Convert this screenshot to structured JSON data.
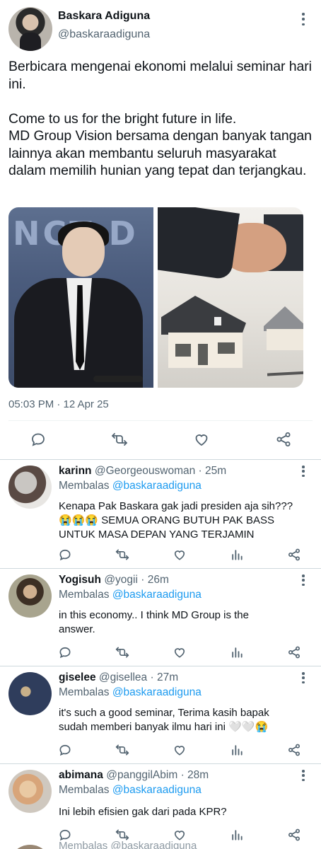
{
  "main_tweet": {
    "author_name": "Baskara Adiguna",
    "author_handle": "@baskaraadiguna",
    "text": "Berbicara mengenai ekonomi melalui seminar hari ini.\n\nCome to us for the bright future in life.\nMD Group Vision bersama dengan banyak tangan lainnya akan membantu seluruh masyarakat dalam memilih hunian yang tepat dan terjangkau.",
    "photo_left_text": "NCT D",
    "timestamp": "05:03 PM · 12 Apr 25",
    "actions": [
      "reply-icon",
      "retweet-icon",
      "like-icon",
      "share-icon"
    ]
  },
  "replies": [
    {
      "name": "karinn",
      "handle": "@Georgeouswoman",
      "time": "· 25m",
      "replying_prefix": "Membalas",
      "replying_to": "@baskaraadiguna",
      "text": "Kenapa Pak Baskara gak jadi presiden aja sih??? 😭😭😭 SEMUA ORANG BUTUH PAK BASS UNTUK MASA DEPAN YANG TERJAMIN"
    },
    {
      "name": "Yogisuh",
      "handle": "@yogii",
      "time": "· 26m",
      "replying_prefix": "Membalas",
      "replying_to": "@baskaraadiguna",
      "text": "in this economy.. I think MD Group is the answer."
    },
    {
      "name": "giselee",
      "handle": "@gisellea",
      "time": "· 27m",
      "replying_prefix": "Membalas",
      "replying_to": "@baskaraadiguna",
      "text": "it's such a good seminar, Terima kasih bapak sudah memberi banyak ilmu hari ini 🤍🤍😭"
    },
    {
      "name": "abimana",
      "handle": "@panggilAbim",
      "time": "· 28m",
      "replying_prefix": "Membalas",
      "replying_to": "@baskaraadiguna",
      "text": "Ini lebih efisien gak dari pada KPR?"
    }
  ],
  "next_reply_partial": "Membalas @baskaraadiguna",
  "colors": {
    "text": "#0f1419",
    "secondary": "#536471",
    "link": "#1d9bf0",
    "divider": "#cfd9de"
  }
}
